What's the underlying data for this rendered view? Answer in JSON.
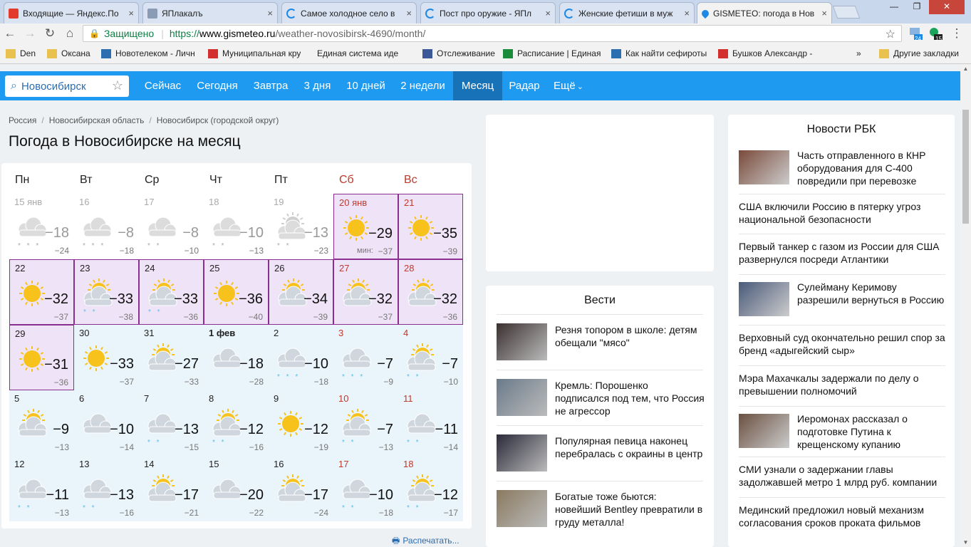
{
  "browser": {
    "tabs": [
      {
        "title": "Входящие — Яндекс.По",
        "icon": "mail-icon",
        "active": false
      },
      {
        "title": "ЯПлакалъ",
        "icon": "site-icon",
        "active": false
      },
      {
        "title": "Самое холодное село в",
        "icon": "loading-icon",
        "active": false
      },
      {
        "title": "Пост про оружие - ЯПл",
        "icon": "loading-icon",
        "active": false
      },
      {
        "title": "Женские фетиши в муж",
        "icon": "loading-icon",
        "active": false
      },
      {
        "title": "GISMETEO: погода в Нов",
        "icon": "drop-icon",
        "active": true
      }
    ],
    "close_glyph": "×",
    "secure_label": "Защищено",
    "url_proto": "https://",
    "url_host": "www.gismeteo.ru",
    "url_path": "/weather-novosibirsk-4690/month/",
    "ext_badge_1": "24",
    "ext_badge_2": "15",
    "bookmarks": [
      {
        "label": "Den",
        "icon": "folder-icon"
      },
      {
        "label": "Оксана",
        "icon": "folder-icon"
      },
      {
        "label": "Новотелеком - Личн",
        "icon": "site-icon"
      },
      {
        "label": "Муниципальная кру",
        "icon": "site-icon"
      },
      {
        "label": "Единая система иде",
        "icon": "none"
      },
      {
        "label": "Отслеживание",
        "icon": "eagle-icon"
      },
      {
        "label": "Расписание | Единая",
        "icon": "site-icon"
      },
      {
        "label": "Как найти сефироты",
        "icon": "site-icon"
      },
      {
        "label": "Бушков Александр -",
        "icon": "site-icon"
      },
      {
        "label": "Другие закладки",
        "icon": "folder-icon"
      }
    ],
    "more_glyph": "»"
  },
  "site": {
    "search_value": "Новосибирск",
    "nav": [
      {
        "label": "Сейчас",
        "active": false
      },
      {
        "label": "Сегодня",
        "active": false
      },
      {
        "label": "Завтра",
        "active": false
      },
      {
        "label": "3 дня",
        "active": false
      },
      {
        "label": "10 дней",
        "active": false
      },
      {
        "label": "2 недели",
        "active": false
      },
      {
        "label": "Месяц",
        "active": true
      },
      {
        "label": "Радар",
        "active": false
      },
      {
        "label": "Ещё",
        "active": false
      }
    ],
    "breadcrumbs": [
      "Россия",
      "Новосибирская область",
      "Новосибирск (городской округ)"
    ],
    "page_title": "Погода в Новосибирске на месяц",
    "weekdays": [
      "Пн",
      "Вт",
      "Ср",
      "Чт",
      "Пт",
      "Сб",
      "Вс"
    ],
    "colors": {
      "brand": "#1e9bf0",
      "nav_active": "#1772b8",
      "weekend": "#c0392b",
      "snow": "#5cbfe6"
    },
    "days": [
      {
        "date": "15 янв",
        "hi": "−18",
        "lo": "−24",
        "icon": "cloud",
        "precip": "* * *",
        "kind": "past"
      },
      {
        "date": "16",
        "hi": "−8",
        "lo": "−18",
        "icon": "cloud",
        "precip": "* * *",
        "kind": "past"
      },
      {
        "date": "17",
        "hi": "−8",
        "lo": "−10",
        "icon": "cloud",
        "precip": "* *",
        "kind": "past"
      },
      {
        "date": "18",
        "hi": "−10",
        "lo": "−13",
        "icon": "cloud",
        "precip": "* *",
        "kind": "past"
      },
      {
        "date": "19",
        "hi": "−13",
        "lo": "−23",
        "icon": "suncloud",
        "precip": "* *",
        "kind": "past"
      },
      {
        "date": "20 янв",
        "hi": "−29",
        "lo": "−37",
        "icon": "sun",
        "precip": "",
        "kind": "current",
        "min_label": "мин:"
      },
      {
        "date": "21",
        "hi": "−35",
        "lo": "−39",
        "icon": "sun",
        "precip": "",
        "kind": "current"
      },
      {
        "date": "22",
        "hi": "−32",
        "lo": "−37",
        "icon": "sun",
        "precip": "",
        "kind": "current"
      },
      {
        "date": "23",
        "hi": "−33",
        "lo": "−38",
        "icon": "suncloud",
        "precip": "* *",
        "kind": "current"
      },
      {
        "date": "24",
        "hi": "−33",
        "lo": "−36",
        "icon": "suncloud",
        "precip": "* *",
        "kind": "current"
      },
      {
        "date": "25",
        "hi": "−36",
        "lo": "−40",
        "icon": "sun",
        "precip": "",
        "kind": "current"
      },
      {
        "date": "26",
        "hi": "−34",
        "lo": "−39",
        "icon": "suncloud",
        "precip": "",
        "kind": "current"
      },
      {
        "date": "27",
        "hi": "−32",
        "lo": "−37",
        "icon": "suncloud",
        "precip": "",
        "kind": "current"
      },
      {
        "date": "28",
        "hi": "−32",
        "lo": "−36",
        "icon": "suncloud",
        "precip": "",
        "kind": "current"
      },
      {
        "date": "29",
        "hi": "−31",
        "lo": "−36",
        "icon": "sun",
        "precip": "",
        "kind": "current"
      },
      {
        "date": "30",
        "hi": "−33",
        "lo": "−37",
        "icon": "sun",
        "precip": "",
        "kind": "future"
      },
      {
        "date": "31",
        "hi": "−27",
        "lo": "−33",
        "icon": "suncloud",
        "precip": "",
        "kind": "future"
      },
      {
        "date": "1 фев",
        "hi": "−18",
        "lo": "−28",
        "icon": "cloud",
        "precip": "",
        "kind": "future",
        "bold": true
      },
      {
        "date": "2",
        "hi": "−10",
        "lo": "−18",
        "icon": "cloud",
        "precip": "* * *",
        "kind": "future"
      },
      {
        "date": "3",
        "hi": "−7",
        "lo": "−9",
        "icon": "cloud",
        "precip": "* * *",
        "kind": "future"
      },
      {
        "date": "4",
        "hi": "−7",
        "lo": "−10",
        "icon": "suncloud",
        "precip": "* *",
        "kind": "future"
      },
      {
        "date": "5",
        "hi": "−9",
        "lo": "−13",
        "icon": "suncloud",
        "precip": "",
        "kind": "future"
      },
      {
        "date": "6",
        "hi": "−10",
        "lo": "−14",
        "icon": "cloud",
        "precip": "",
        "kind": "future"
      },
      {
        "date": "7",
        "hi": "−13",
        "lo": "−15",
        "icon": "cloud",
        "precip": "* *",
        "kind": "future"
      },
      {
        "date": "8",
        "hi": "−12",
        "lo": "−16",
        "icon": "suncloud",
        "precip": "* *",
        "kind": "future"
      },
      {
        "date": "9",
        "hi": "−12",
        "lo": "−19",
        "icon": "sun",
        "precip": "",
        "kind": "future"
      },
      {
        "date": "10",
        "hi": "−7",
        "lo": "−13",
        "icon": "suncloud",
        "precip": "* *",
        "kind": "future"
      },
      {
        "date": "11",
        "hi": "−11",
        "lo": "−14",
        "icon": "cloud",
        "precip": "* *",
        "kind": "future"
      },
      {
        "date": "12",
        "hi": "−11",
        "lo": "−13",
        "icon": "cloud",
        "precip": "* *",
        "kind": "future"
      },
      {
        "date": "13",
        "hi": "−13",
        "lo": "−16",
        "icon": "cloud",
        "precip": "* *",
        "kind": "future"
      },
      {
        "date": "14",
        "hi": "−17",
        "lo": "−21",
        "icon": "suncloud",
        "precip": "",
        "kind": "future"
      },
      {
        "date": "15",
        "hi": "−20",
        "lo": "−22",
        "icon": "cloud",
        "precip": "",
        "kind": "future"
      },
      {
        "date": "16",
        "hi": "−17",
        "lo": "−24",
        "icon": "suncloud",
        "precip": "",
        "kind": "future"
      },
      {
        "date": "17",
        "hi": "−10",
        "lo": "−18",
        "icon": "cloud",
        "precip": "* *",
        "kind": "future"
      },
      {
        "date": "18",
        "hi": "−12",
        "lo": "−17",
        "icon": "suncloud",
        "precip": "* *",
        "kind": "future"
      }
    ],
    "print_label": "Распечатать..."
  },
  "vesti": {
    "header": "Вести",
    "items": [
      "Резня топором в школе: детям обещали \"мясо\"",
      "Кремль: Порошенко подписался под тем, что Россия не агрессор",
      "Популярная певица наконец перебралась с окраины в центр",
      "Богатые тоже бьются: новейший Bentley превратили в груду металла!"
    ]
  },
  "rbk": {
    "header": "Новости РБК",
    "items": [
      {
        "text": "Часть отправленного в КНР оборудования для С-400 повредили при перевозке",
        "image": true
      },
      {
        "text": "США включили Россию в пятерку угроз национальной безопасности",
        "image": false
      },
      {
        "text": "Первый танкер с газом из России для США развернулся посреди Атлантики",
        "image": false
      },
      {
        "text": "Сулейману Керимову разрешили вернуться в Россию",
        "image": true
      },
      {
        "text": "Верховный суд окончательно решил спор за бренд «адыгейский сыр»",
        "image": false
      },
      {
        "text": "Мэра Махачкалы задержали по делу о превышении полномочий",
        "image": false
      },
      {
        "text": "Иеромонах рассказал о подготовке Путина к крещенскому купанию",
        "image": true
      },
      {
        "text": "СМИ узнали о задержании главы задолжавшей метро 1 млрд руб. компании",
        "image": false
      },
      {
        "text": "Мединский предложил новый механизм согласования сроков проката фильмов",
        "image": false
      }
    ]
  }
}
